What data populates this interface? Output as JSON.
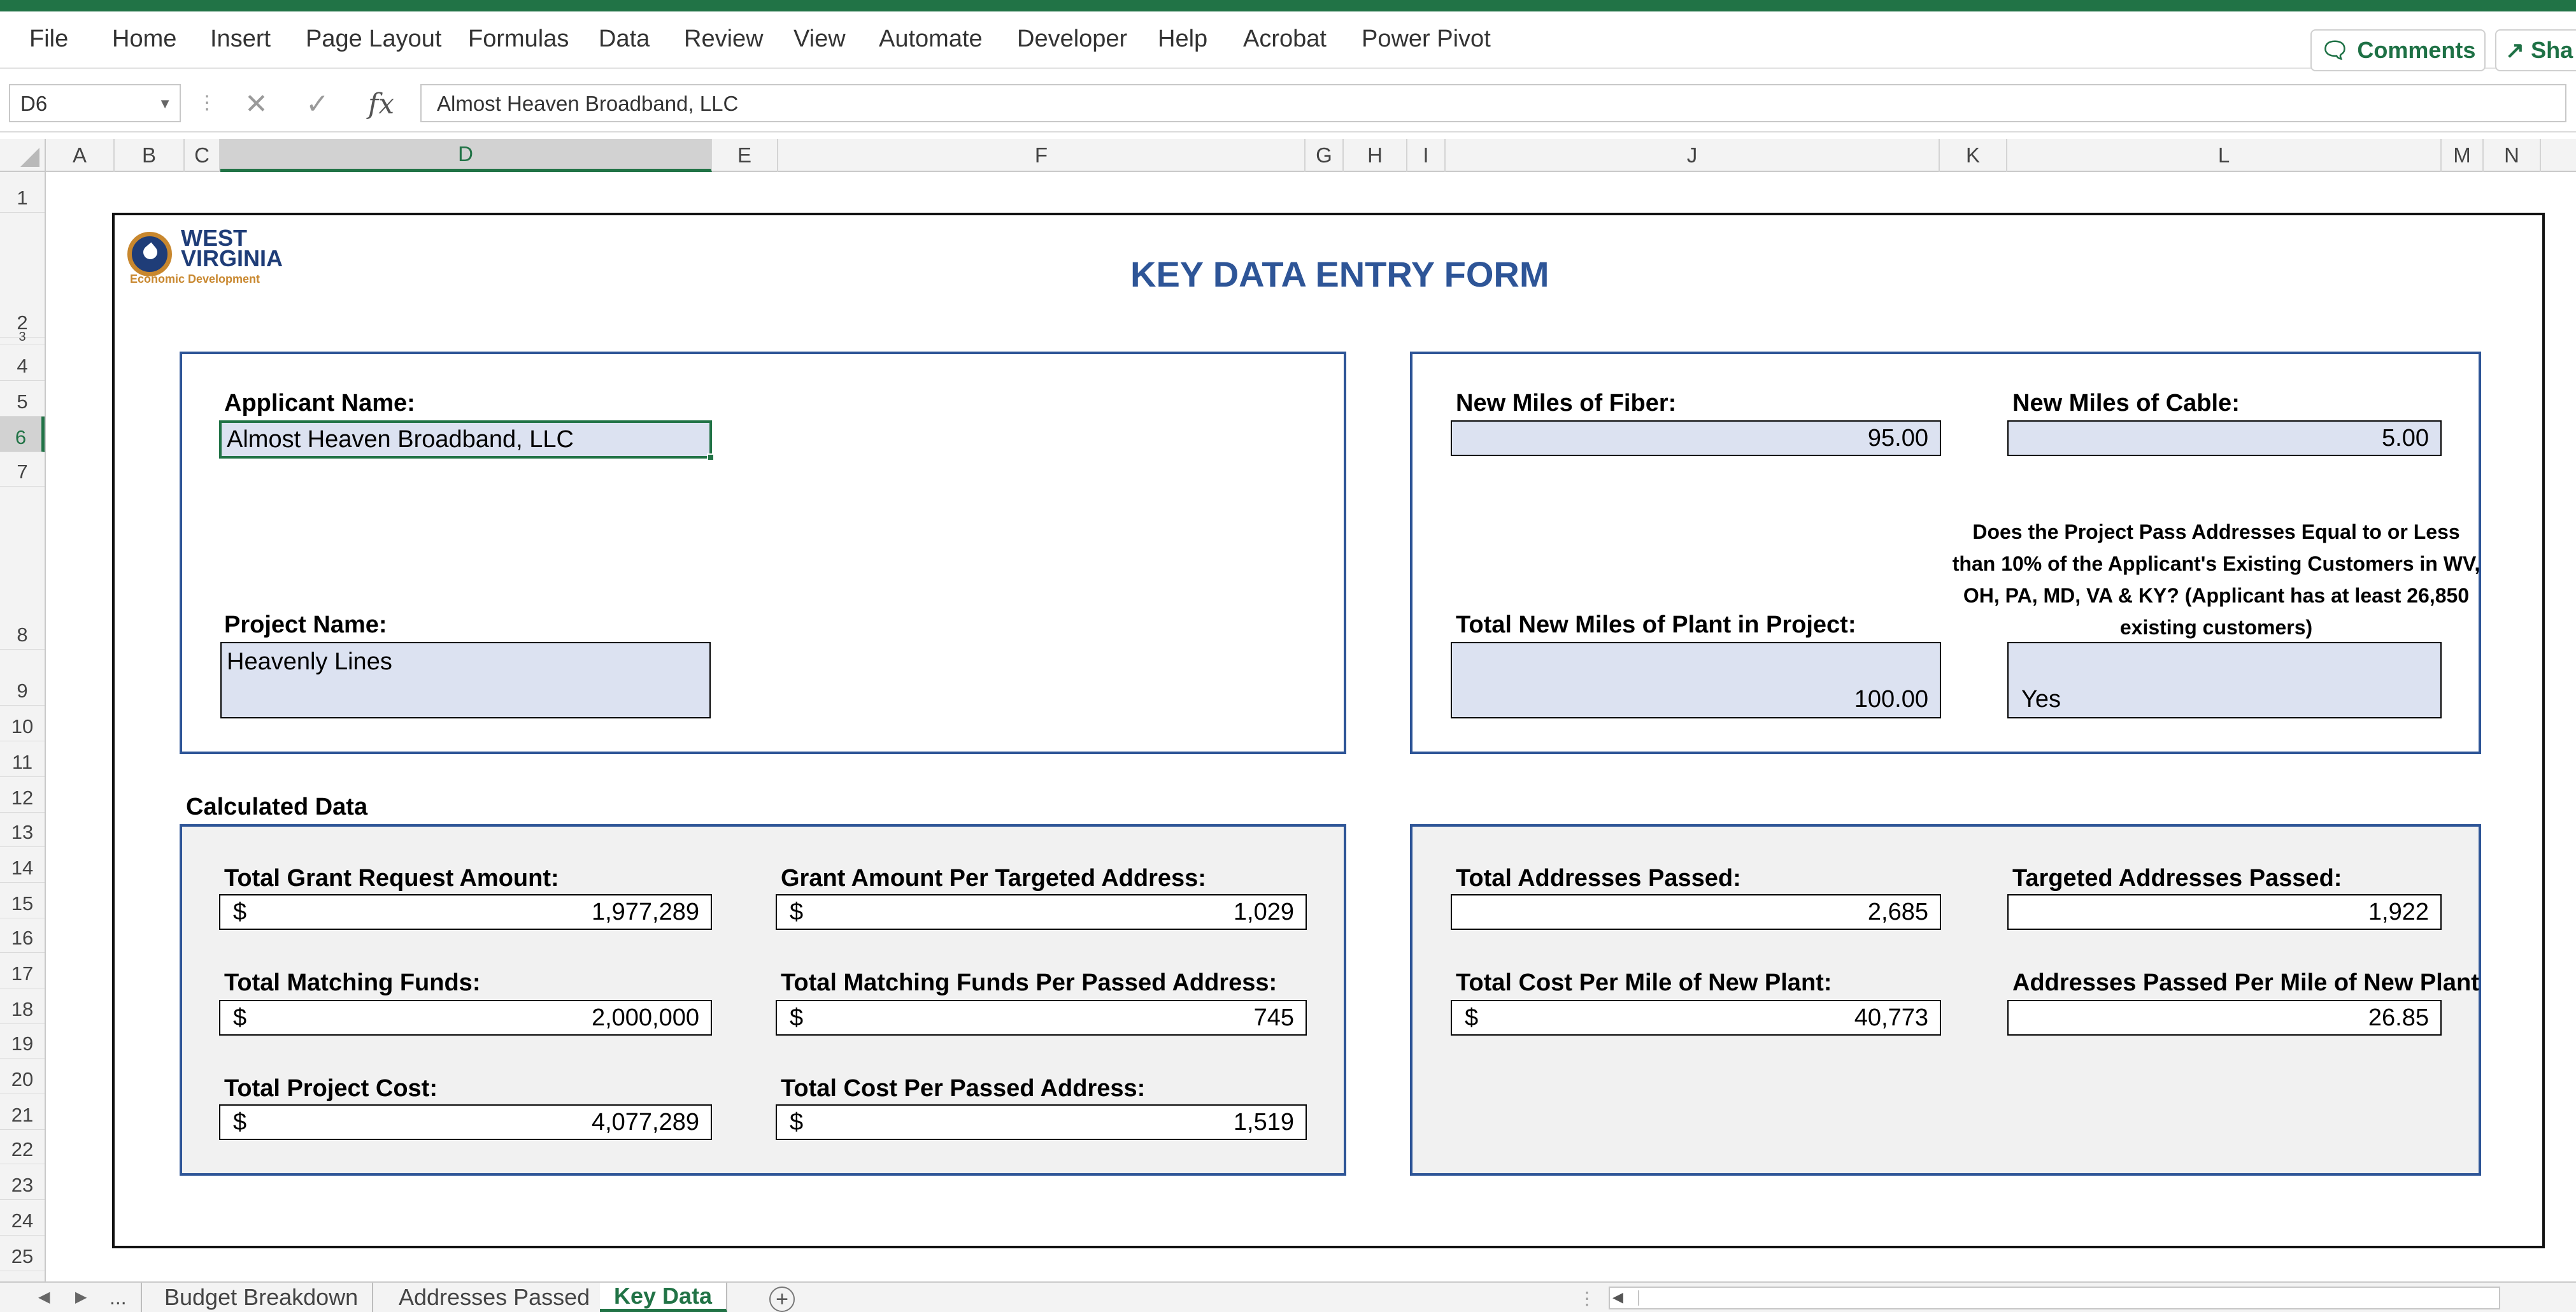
{
  "menu": {
    "items": [
      "File",
      "Home",
      "Insert",
      "Page Layout",
      "Formulas",
      "Data",
      "Review",
      "View",
      "Automate",
      "Developer",
      "Help",
      "Acrobat",
      "Power Pivot"
    ],
    "comments_label": "Comments",
    "share_label": "Sha"
  },
  "formula_bar": {
    "cell_ref": "D6",
    "fx_label": "fx",
    "content": "Almost Heaven Broadband, LLC"
  },
  "columns": [
    "A",
    "B",
    "C",
    "D",
    "E",
    "F",
    "G",
    "H",
    "I",
    "J",
    "K",
    "L",
    "M",
    "N"
  ],
  "selected_column": "D",
  "rows": [
    "1",
    "2",
    "3",
    "4",
    "5",
    "6",
    "7",
    "8",
    "9",
    "10",
    "11",
    "12",
    "13",
    "14",
    "15",
    "16",
    "17",
    "18",
    "19",
    "20",
    "21",
    "22",
    "23",
    "24",
    "25"
  ],
  "selected_row": "6",
  "logo": {
    "line1": "WEST",
    "line2": "VIRGINIA",
    "line3": "Economic Development"
  },
  "form": {
    "title": "KEY DATA ENTRY FORM",
    "applicant_label": "Applicant Name:",
    "applicant_value": "Almost Heaven Broadband, LLC",
    "project_label": "Project Name:",
    "project_value": "Heavenly Lines",
    "fiber_label": "New Miles of Fiber:",
    "fiber_value": "95.00",
    "cable_label": "New Miles of Cable:",
    "cable_value": "5.00",
    "total_miles_label": "Total New Miles of Plant in Project:",
    "total_miles_value": "100.00",
    "question_text": "Does the Project Pass Addresses Equal to or Less than 10% of the Applicant's Existing Customers in WV, OH, PA, MD, VA & KY? (Applicant has at least 26,850 existing customers)",
    "question_value": "Yes",
    "calculated_heading": "Calculated Data",
    "currency_symbol": "$",
    "grant_label": "Total Grant Request Amount:",
    "grant_value": "1,977,289",
    "grant_per_addr_label": "Grant Amount Per Targeted Address:",
    "grant_per_addr_value": "1,029",
    "matching_label": "Total Matching Funds:",
    "matching_value": "2,000,000",
    "matching_per_addr_label": "Total Matching Funds Per Passed Address:",
    "matching_per_addr_value": "745",
    "project_cost_label": "Total Project Cost:",
    "project_cost_value": "4,077,289",
    "cost_per_addr_label": "Total Cost Per Passed Address:",
    "cost_per_addr_value": "1,519",
    "addresses_passed_label": "Total Addresses Passed:",
    "addresses_passed_value": "2,685",
    "targeted_label": "Targeted Addresses Passed:",
    "targeted_value": "1,922",
    "cost_per_mile_label": "Total Cost Per Mile of New Plant:",
    "cost_per_mile_value": "40,773",
    "addr_per_mile_label": "Addresses Passed Per Mile of New Plant",
    "addr_per_mile_value": "26.85"
  },
  "sheet_tabs": {
    "ellipsis": "...",
    "tabs": [
      "Budget Breakdown",
      "Addresses Passed",
      "Key Data"
    ],
    "active_tab": "Key Data"
  },
  "colors": {
    "excel_green": "#217346",
    "title_blue": "#2e5597",
    "input_blue": "#dce2f1",
    "logo_gold": "#c8872e"
  }
}
